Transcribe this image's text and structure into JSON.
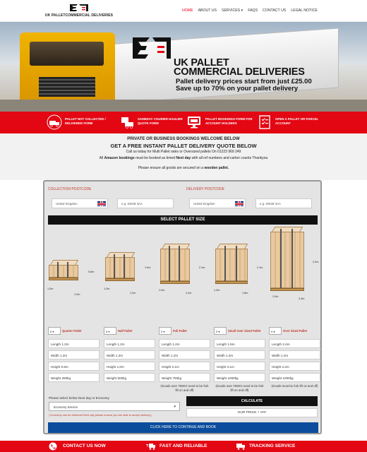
{
  "brand": {
    "name": "UK PALLETCOMMERCIAL DELIVERIES",
    "accent": "#e30613",
    "button_blue": "#0b4c9c"
  },
  "nav": {
    "items": [
      "HOME",
      "ABOUT US",
      "SERVICES",
      "FAQS",
      "CONTACT US",
      "LEGAL NOTICE"
    ],
    "active": "HOME"
  },
  "hero": {
    "title_line1": "UK PALLET",
    "title_line2": "COMMERCIAL DELIVERIES",
    "sub_line1": "Pallet delivery prices start from just £25.00",
    "sub_line2": "Save up to 70% on your pallet delivery"
  },
  "redbar": {
    "items": [
      {
        "line1": "PALLET NOT COLLECTED /",
        "line2": "DELIVERED FORM",
        "icon": "truck-icon"
      },
      {
        "line1": "SAMEDAY COURIER HAULIER",
        "line2": "QUOTE FORM",
        "icon": "courier-icon"
      },
      {
        "line1": "PALLET BOOKINGS FORM FOR",
        "line2": "ACCOUNT HOLDERS",
        "icon": "monitor-icon"
      },
      {
        "line1": "OPEN A PALLET OR PARCEL",
        "line2": "ACCOUNT",
        "icon": "checklist-icon"
      }
    ]
  },
  "intro": {
    "line1": "PRIVATE OR BUSINESS BOOKINGS WELCOME BELOW",
    "line2": "GET A FREE INSTANT PALLET DELIVERY QUOTE BELOW",
    "line3": "Call us today for Multi Pallet rates or Oversized pallets On 01223 969 249",
    "line4_a": "All ",
    "line4_b": "Amazon bookings",
    "line4_c": " must be booked as timed ",
    "line4_d": "Next day",
    "line4_e": " with all ref numbers and carton counts Thankyou",
    "line5_a": "Please ensure all goods are secured on a ",
    "line5_b": "wooden pallet."
  },
  "form": {
    "collection_label": "COLLECTION POSTCODE",
    "delivery_label": "DELIVERY POSTCODE",
    "country": "United Kingdom",
    "postcode_placeholder": "e.g. SW1B 3AA",
    "select_pallet_size": "SELECT PALLET SIZE",
    "field_labels": {
      "length": "Length",
      "width": "Width",
      "height": "Height",
      "weight": "Weight"
    },
    "pallets": [
      {
        "name": "Quarter Pallet",
        "qty": "0",
        "length": "1.2m",
        "width": "1.2m",
        "height": "0.6m",
        "weight": "250kg",
        "dim_h": "0.6m",
        "dim_w": "1.2m",
        "dim_l": "1.2m",
        "note": ""
      },
      {
        "name": "Half Pallet",
        "qty": "0",
        "length": "1.2m",
        "width": "1.2m",
        "height": "1.0m",
        "weight": "500kg",
        "dim_h": "1.0m",
        "dim_w": "1.2m",
        "dim_l": "1.2m",
        "note": ""
      },
      {
        "name": "Full Pallet",
        "qty": "0",
        "length": "1.2m",
        "width": "1.2m",
        "height": "2.1m",
        "weight": "750kg",
        "dim_h": "2.1m",
        "dim_w": "1.2m",
        "dim_l": "1.2m",
        "note": "(Goods over 750KG need to be fork lift on and off)"
      },
      {
        "name": "Small Over Sized Pallet",
        "qty": "0",
        "length": "1.6m",
        "width": "1.2m",
        "height": "2.1m",
        "weight": "1000kg",
        "dim_h": "2.1m",
        "dim_w": "1.6m",
        "dim_l": "1.2m",
        "note": "(Goods over 750KG need to be fork lift on and off)"
      },
      {
        "name": "Over Sized Pallet",
        "qty": "0",
        "length": "2.4m",
        "width": "1.2m",
        "height": "2.2m",
        "weight": "1000kg",
        "dim_h": "2.2m",
        "dim_w": "2.4m",
        "dim_l": "1.2m",
        "note": "(Goods must be fork lift on and off)"
      }
    ],
    "service_label": "Please select below Next day or Economy",
    "service_value": "Economy Service",
    "service_note": "( Economy can be delivered Next day please ensure you are able to accept delivery )",
    "calculate": "CALCULATE",
    "price": "OUR PRICE + VAT",
    "continue": "CLICK HERE TO CONTINUE AND BOOK"
  },
  "footer": {
    "items": [
      "CONTACT US NOW",
      "FAST AND RELIABLE",
      "TRACKING SERVICE"
    ]
  }
}
